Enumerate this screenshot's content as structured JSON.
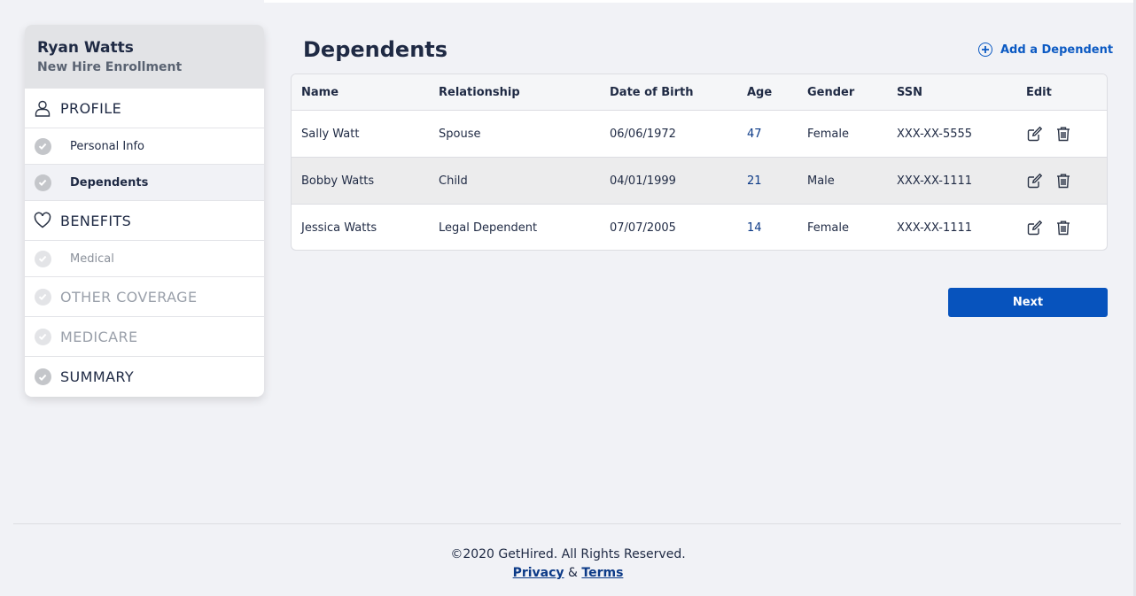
{
  "sidebar": {
    "user_name": "Ryan Watts",
    "subtitle": "New Hire Enrollment",
    "sections": {
      "profile": {
        "label": "PROFILE",
        "icon": "person-icon"
      },
      "benefits": {
        "label": "BENEFITS",
        "icon": "heart-icon"
      },
      "other_coverage": {
        "label": "OTHER COVERAGE",
        "icon": "check-circle-icon"
      },
      "medicare": {
        "label": "MEDICARE",
        "icon": "check-circle-icon"
      },
      "summary": {
        "label": "SUMMARY",
        "icon": "check-circle-icon"
      }
    },
    "items": {
      "personal_info": "Personal Info",
      "dependents": "Dependents",
      "medical": "Medical"
    },
    "active_item": "Dependents"
  },
  "main": {
    "title": "Dependents",
    "add_label": "Add a Dependent",
    "next_label": "Next"
  },
  "table": {
    "headers": [
      "Name",
      "Relationship",
      "Date of Birth",
      "Age",
      "Gender",
      "SSN",
      "Edit"
    ],
    "rows": [
      [
        "Sally Watt",
        "Spouse",
        "06/06/1972",
        "47",
        "Female",
        "XXX-XX-5555"
      ],
      [
        "Bobby Watts",
        "Child",
        "04/01/1999",
        "21",
        "Male",
        "XXX-XX-1111"
      ],
      [
        "Jessica Watts",
        "Legal Dependent",
        "07/07/2005",
        "14",
        "Female",
        "XXX-XX-1111"
      ]
    ],
    "row_actions": [
      "edit-icon",
      "trash-icon"
    ]
  },
  "footer": {
    "copyright": "©2020 GetHired. All Rights Reserved.",
    "privacy": "Privacy",
    "amp": "&",
    "terms": "Terms"
  },
  "colors": {
    "accent": "#0753bd",
    "link": "#0c5ac3",
    "background": "#f1f2f6",
    "text": "#1f2a44"
  }
}
